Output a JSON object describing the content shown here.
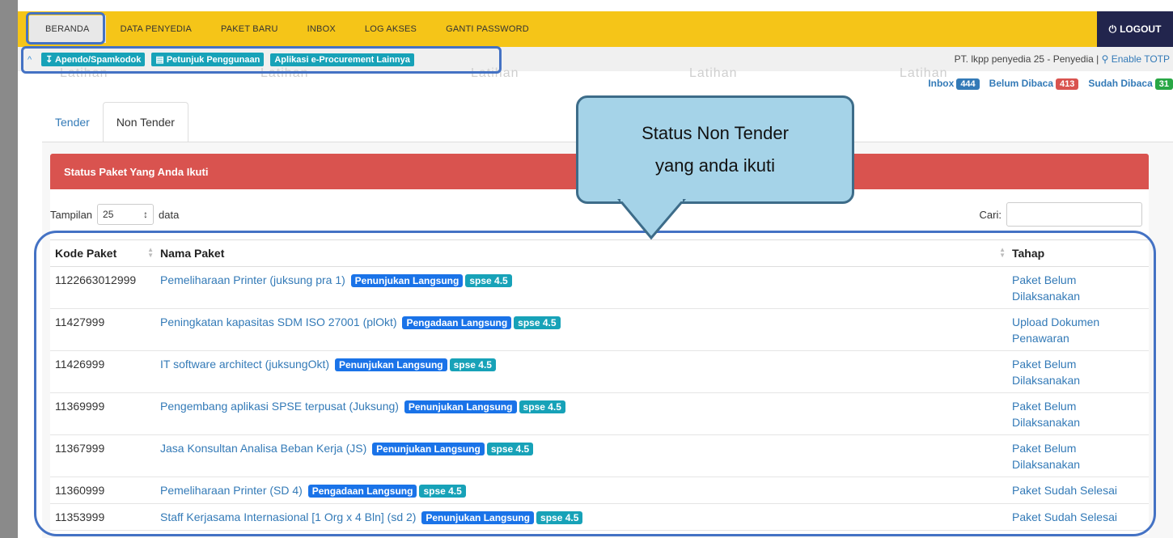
{
  "nav": {
    "items": [
      "BERANDA",
      "DATA PENYEDIA",
      "PAKET BARU",
      "INBOX",
      "LOG AKSES",
      "GANTI PASSWORD"
    ],
    "logout_label": "LOGOUT",
    "accent_color": "#f5c518"
  },
  "toolbar": {
    "links": [
      "Apendo/Spamkodok",
      "Petunjuk Penggunaan",
      "Aplikasi e-Procurement Lainnya"
    ],
    "user_info": "PT. lkpp penyedia 25 - Penyedia |",
    "totp_label": "Enable TOTP"
  },
  "watermark": "Latihan",
  "messages": {
    "inbox_label": "Inbox",
    "inbox_count": "444",
    "unread_label": "Belum Dibaca",
    "unread_count": "413",
    "read_label": "Sudah Dibaca",
    "read_count": "31"
  },
  "tabs": [
    "Tender",
    "Non Tender"
  ],
  "panel": {
    "title": "Status Paket Yang Anda Ikuti"
  },
  "controls": {
    "show_label": "Tampilan",
    "page_size": "25",
    "data_label": "data",
    "search_label": "Cari:"
  },
  "table": {
    "columns": [
      "Kode Paket",
      "Nama Paket",
      "Tahap"
    ],
    "rows": [
      {
        "kode": "1122663012999",
        "nama": "Pemeliharaan Printer (juksung pra 1)",
        "metode": "Penunjukan Langsung",
        "versi": "spse 4.5",
        "tahap": "Paket Belum Dilaksanakan"
      },
      {
        "kode": "11427999",
        "nama": "Peningkatan kapasitas SDM ISO 27001 (plOkt)",
        "metode": "Pengadaan Langsung",
        "versi": "spse 4.5",
        "tahap": "Upload Dokumen Penawaran"
      },
      {
        "kode": "11426999",
        "nama": "IT software architect (juksungOkt)",
        "metode": "Penunjukan Langsung",
        "versi": "spse 4.5",
        "tahap": "Paket Belum Dilaksanakan"
      },
      {
        "kode": "11369999",
        "nama": "Pengembang aplikasi SPSE terpusat (Juksung)",
        "metode": "Penunjukan Langsung",
        "versi": "spse 4.5",
        "tahap": "Paket Belum Dilaksanakan"
      },
      {
        "kode": "11367999",
        "nama": "Jasa Konsultan Analisa Beban Kerja (JS)",
        "metode": "Penunjukan Langsung",
        "versi": "spse 4.5",
        "tahap": "Paket Belum Dilaksanakan"
      },
      {
        "kode": "11360999",
        "nama": "Pemeliharaan Printer (SD 4)",
        "metode": "Pengadaan Langsung",
        "versi": "spse 4.5",
        "tahap": "Paket Sudah Selesai"
      },
      {
        "kode": "11353999",
        "nama": "Staff Kerjasama Internasional [1 Org x 4 Bln] (sd 2)",
        "metode": "Penunjukan Langsung",
        "versi": "spse 4.5",
        "tahap": "Paket Sudah Selesai"
      }
    ]
  },
  "callout": {
    "line1": "Status Non Tender",
    "line2": "yang anda ikuti"
  }
}
